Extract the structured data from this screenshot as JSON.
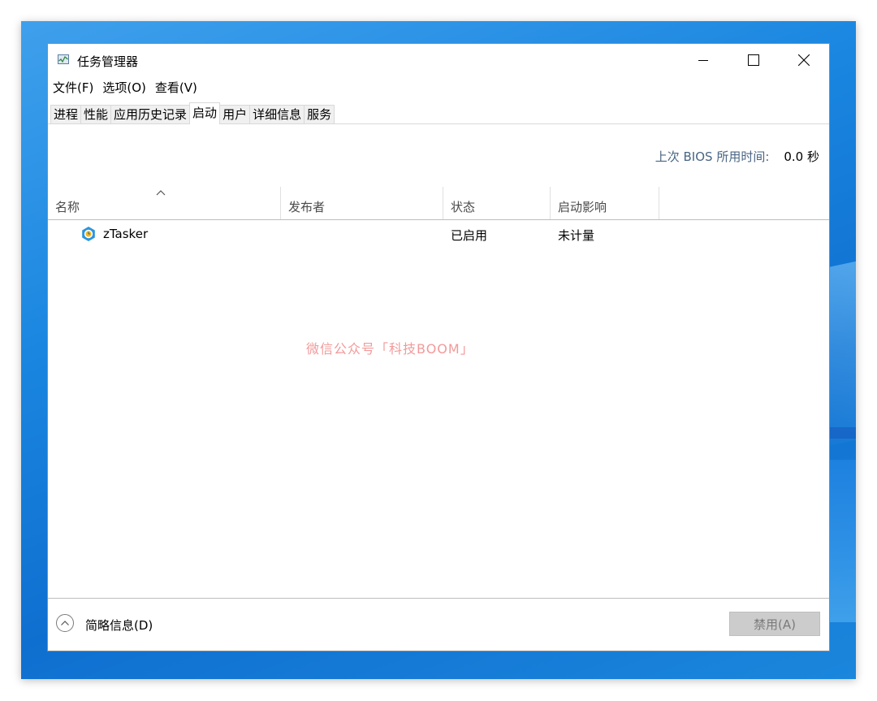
{
  "window": {
    "title": "任务管理器"
  },
  "menu": {
    "items": [
      "文件(F)",
      "选项(O)",
      "查看(V)"
    ]
  },
  "tabs": {
    "items": [
      "进程",
      "性能",
      "应用历史记录",
      "启动",
      "用户",
      "详细信息",
      "服务"
    ],
    "active": "启动"
  },
  "bios": {
    "label": "上次 BIOS 所用时间:",
    "value": "0.0 秒"
  },
  "table": {
    "columns": [
      "名称",
      "发布者",
      "状态",
      "启动影响"
    ],
    "sorted_column": "名称",
    "rows": [
      {
        "name": "zTasker",
        "publisher": "",
        "status": "已启用",
        "impact": "未计量",
        "icon": "ztasker-icon"
      }
    ]
  },
  "watermark": "微信公众号「科技BOOM」",
  "footer": {
    "fewer_details": "简略信息(D)",
    "disable_button": "禁用(A)"
  },
  "colors": {
    "desktop": "#1a86e0",
    "bios_label": "#4a6584",
    "watermark": "#f29a9a",
    "button_disabled": "#cccccc"
  }
}
